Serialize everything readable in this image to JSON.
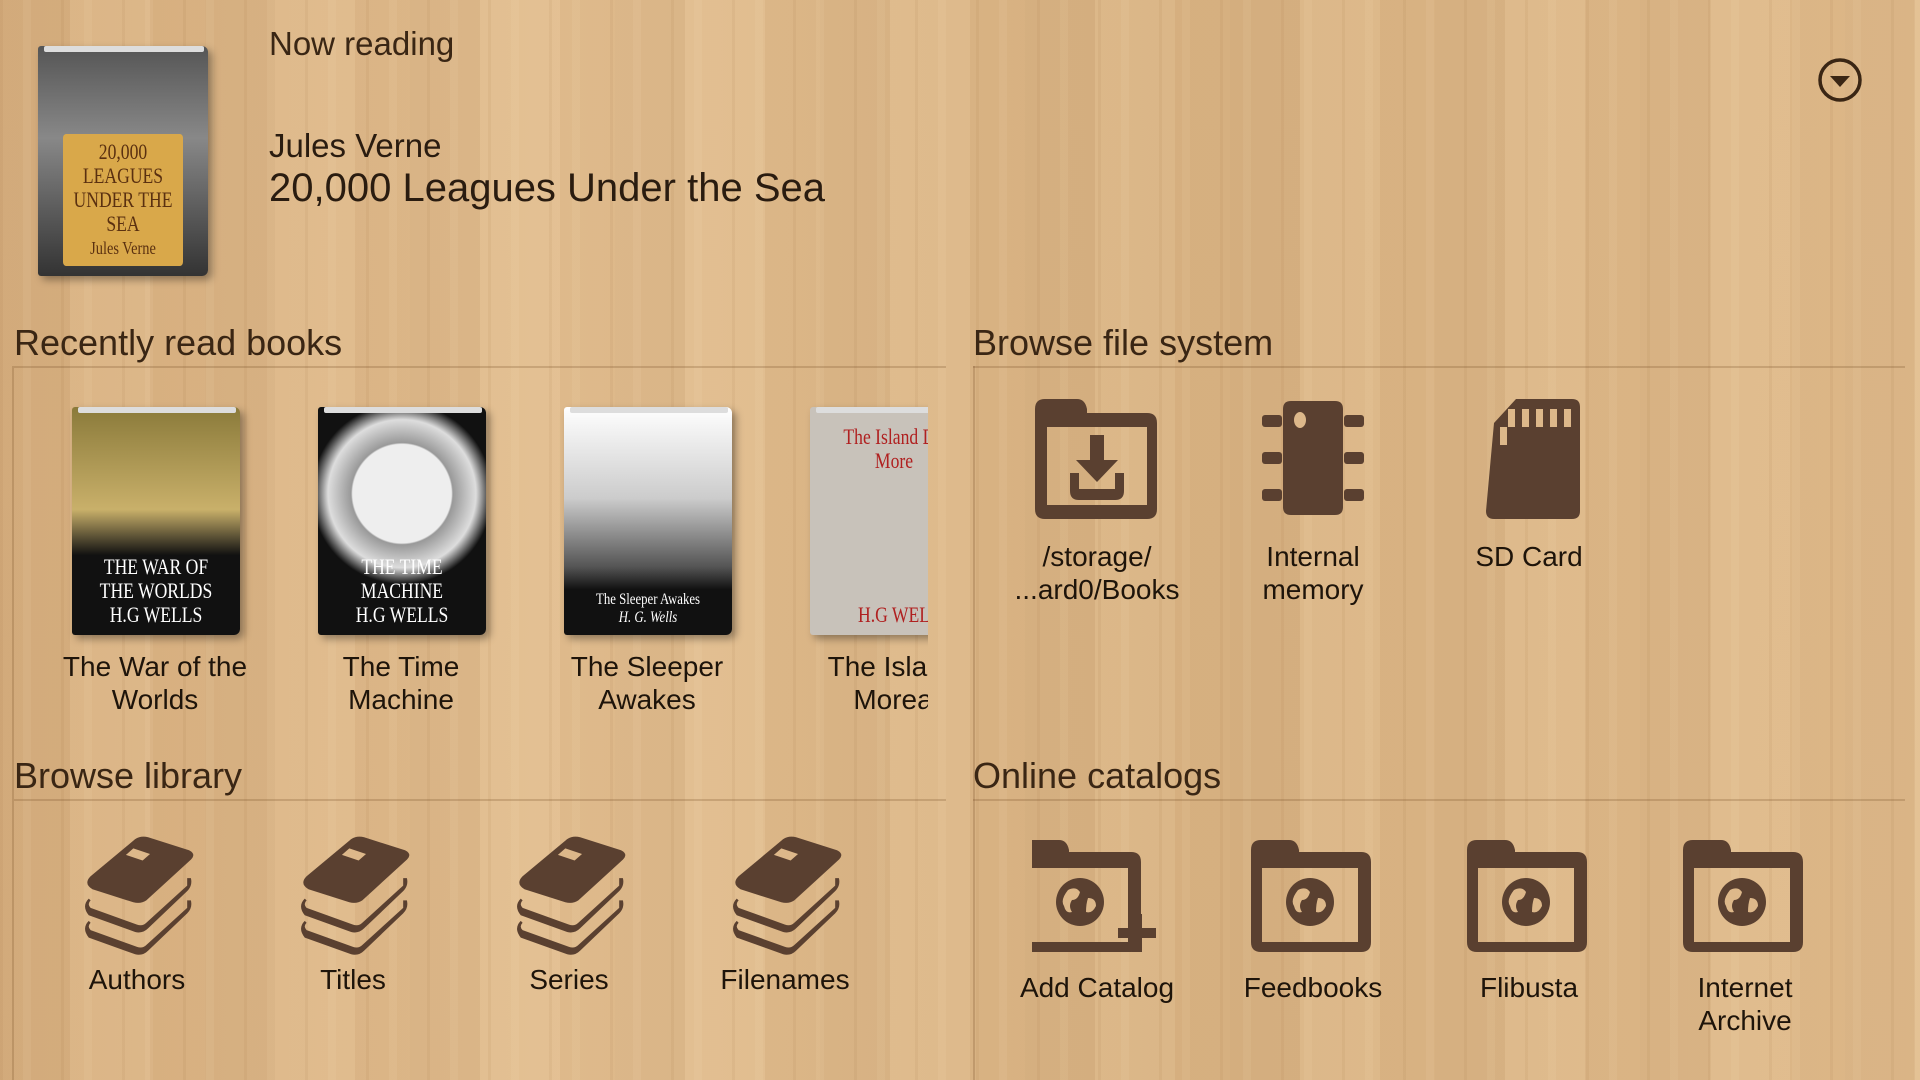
{
  "now_reading": {
    "heading": "Now reading",
    "author": "Jules Verne",
    "title": "20,000 Leagues Under the Sea",
    "cover_text": "20,000 LEAGUES UNDER THE SEA",
    "cover_author": "Jules Verne",
    "menu_icon": "chevron-down-circle-icon"
  },
  "recent": {
    "heading": "Recently read books",
    "books": [
      {
        "title": "The War of the Worlds",
        "cover_text": "THE WAR OF THE WORLDS",
        "cover_author": "H.G WELLS"
      },
      {
        "title": "The Time Machine",
        "cover_text": "THE TIME MACHINE",
        "cover_author": "H.G WELLS"
      },
      {
        "title": "The Sleeper Awakes",
        "cover_text": "The Sleeper Awakes",
        "cover_author": "H. G. Wells"
      },
      {
        "title": "The Island Morea",
        "cover_text": "The Island Dr. More",
        "cover_author": "H.G WEL"
      }
    ]
  },
  "filesystem": {
    "heading": "Browse file system",
    "items": [
      {
        "label_line1": "/storage/",
        "label_line2": "...ard0/Books",
        "icon": "folder-download-icon"
      },
      {
        "label_line1": "Internal",
        "label_line2": "memory",
        "icon": "memory-chip-icon"
      },
      {
        "label_line1": "SD Card",
        "label_line2": "",
        "icon": "sd-card-icon"
      }
    ]
  },
  "library": {
    "heading": "Browse library",
    "items": [
      "Authors",
      "Titles",
      "Series",
      "Filenames"
    ]
  },
  "catalogs": {
    "heading": "Online catalogs",
    "items": [
      {
        "label_line1": "Add Catalog",
        "label_line2": ""
      },
      {
        "label_line1": "Feedbooks",
        "label_line2": ""
      },
      {
        "label_line1": "Flibusta",
        "label_line2": ""
      },
      {
        "label_line1": "Internet",
        "label_line2": "Archive"
      }
    ]
  },
  "colors": {
    "icon": "#5a4030",
    "text": "#1e140a"
  }
}
